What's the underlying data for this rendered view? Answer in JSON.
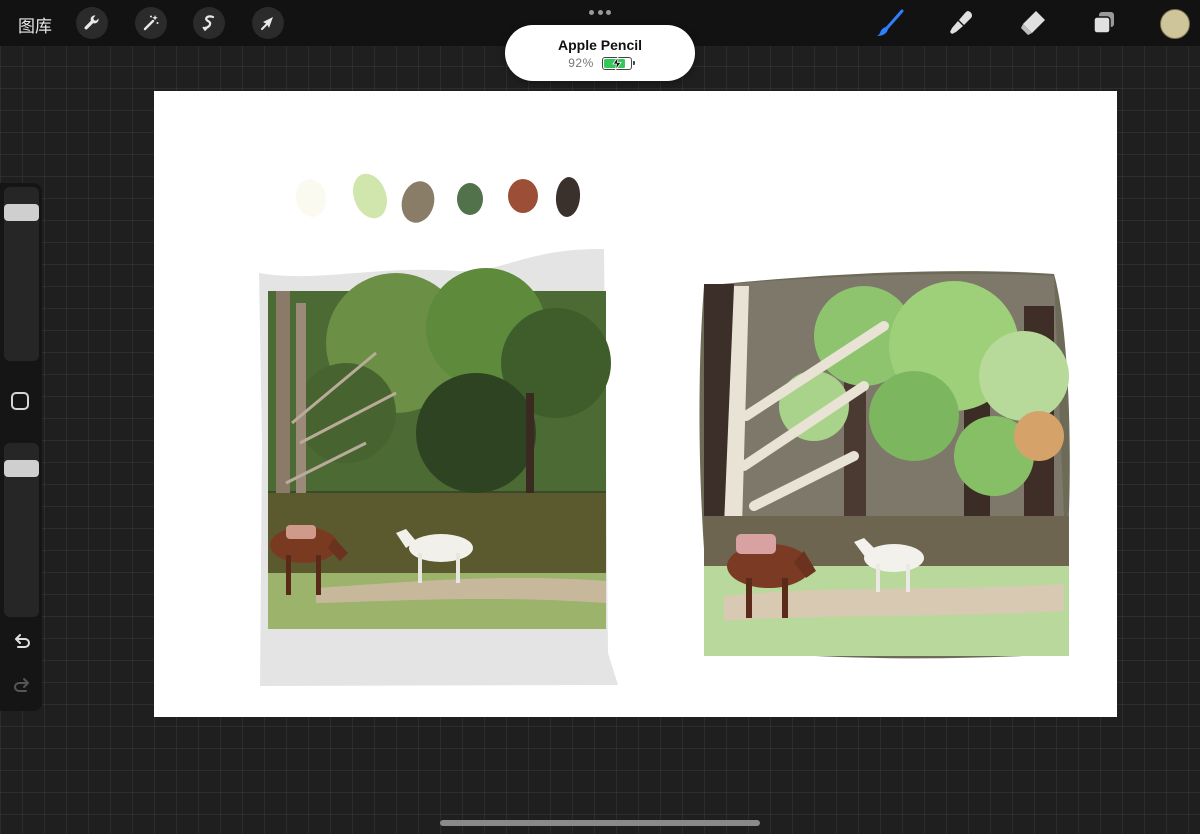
{
  "toolbar": {
    "gallery_label": "图库",
    "left_tools": [
      {
        "name": "actions",
        "icon": "wrench-icon"
      },
      {
        "name": "adjustments",
        "icon": "magic-wand-icon"
      },
      {
        "name": "selection",
        "icon": "selection-icon"
      },
      {
        "name": "transform",
        "icon": "arrow-cursor-icon"
      }
    ],
    "right_tools": [
      {
        "name": "brush",
        "icon": "brush-icon",
        "active": true
      },
      {
        "name": "smudge",
        "icon": "smudge-icon"
      },
      {
        "name": "eraser",
        "icon": "eraser-icon"
      },
      {
        "name": "layers",
        "icon": "layers-icon"
      }
    ],
    "current_color": "#cfc59a",
    "active_color": "#2f80ff"
  },
  "pencil_popup": {
    "device_name": "Apple Pencil",
    "battery_text": "92%",
    "battery_level": 0.92,
    "charging": true
  },
  "canvas": {
    "palette_swatches": [
      "#fbfaf1",
      "#d1e6ad",
      "#8a7d68",
      "#51724a",
      "#9c4f36",
      "#3a302c"
    ],
    "reference_photo": "horses in forest clearing photo",
    "painting": "digital painting of horses in forest"
  },
  "sidebar": {
    "brush_size_level": 0.9,
    "opacity_level": 0.9,
    "undo_icon": "undo-icon",
    "redo_icon": "redo-icon"
  }
}
